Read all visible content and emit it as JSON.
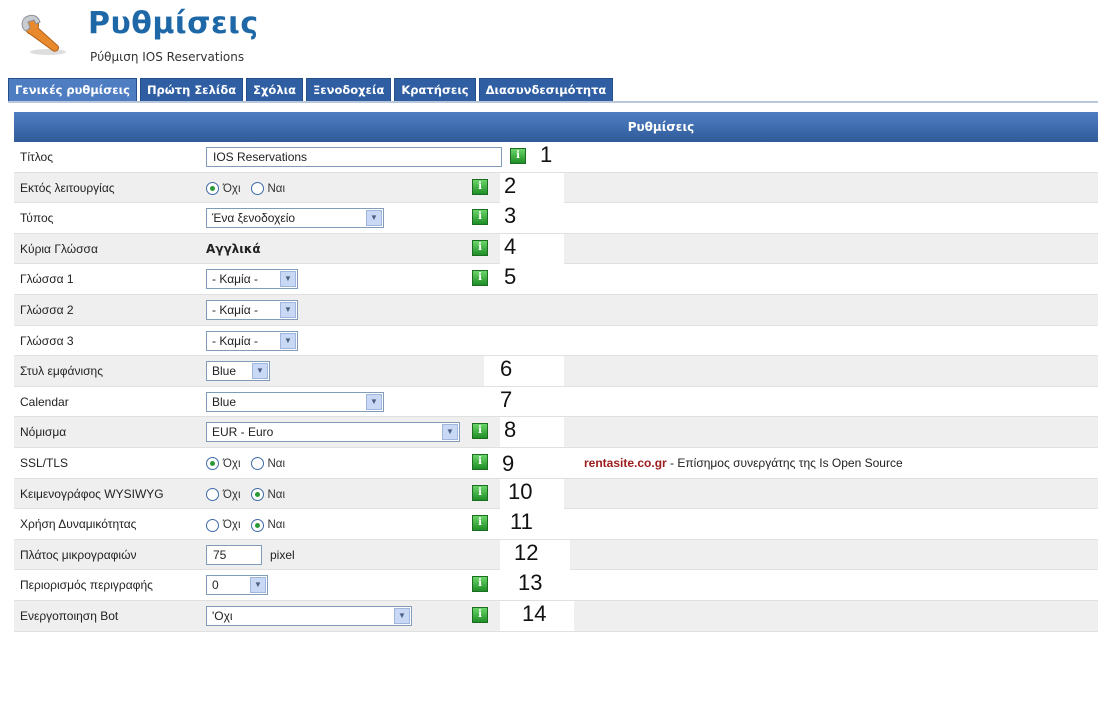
{
  "header": {
    "title": "Ρυθμίσεις",
    "subtitle": "Ρύθμιση IOS Reservations",
    "icon": "wrench-icon"
  },
  "tabs": [
    {
      "label": "Γενικές ρυθμίσεις",
      "active": true
    },
    {
      "label": "Πρώτη Σελίδα"
    },
    {
      "label": "Σχόλια"
    },
    {
      "label": "Ξενοδοχεία"
    },
    {
      "label": "Κρατήσεις"
    },
    {
      "label": "Διασυνδεσιμότητα"
    }
  ],
  "panel": {
    "heading": "Ρυθμίσεις"
  },
  "rows": {
    "title": {
      "label": "Τίτλος",
      "value": "IOS Reservations",
      "note": "1"
    },
    "offline": {
      "label": "Εκτός λειτουργίας",
      "opt_no": "Όχι",
      "opt_yes": "Ναι",
      "note": "2"
    },
    "type": {
      "label": "Τύπος",
      "value": "Ένα ξενοδοχείο",
      "note": "3"
    },
    "main_lang": {
      "label": "Κύρια Γλώσσα",
      "value": "Αγγλικά",
      "note": "4"
    },
    "lang1": {
      "label": "Γλώσσα 1",
      "value": "- Καμία -",
      "note": "5"
    },
    "lang2": {
      "label": "Γλώσσα 2",
      "value": "- Καμία -"
    },
    "lang3": {
      "label": "Γλώσσα 3",
      "value": "- Καμία -"
    },
    "style": {
      "label": "Στυλ εμφάνισης",
      "value": "Blue",
      "note": "6"
    },
    "calendar": {
      "label": "Calendar",
      "value": "Blue",
      "note": "7"
    },
    "currency": {
      "label": "Νόμισμα",
      "value": "EUR - Euro",
      "note": "8"
    },
    "ssl": {
      "label": "SSL/TLS",
      "opt_no": "Όχι",
      "opt_yes": "Ναι",
      "note": "9",
      "promo_site": "rentasite.co.gr",
      "promo_text": " - Επίσημος συνεργάτης της Is Open Source"
    },
    "wysiwyg": {
      "label": "Κειμενογράφος WYSIWYG",
      "opt_no": "Όχι",
      "opt_yes": "Ναι",
      "note": "10"
    },
    "dynamic": {
      "label": "Χρήση Δυναμικότητας",
      "opt_no": "Όχι",
      "opt_yes": "Ναι",
      "note": "11"
    },
    "thumb": {
      "label": "Πλάτος μικρογραφιών",
      "value": "75",
      "unit": "pixel",
      "note": "12"
    },
    "desc_limit": {
      "label": "Περιορισμός περιγραφής",
      "value": "0",
      "note": "13"
    },
    "bot": {
      "label": "Ενεργοποιηση Bot",
      "value": "'Οχι",
      "note": "14"
    }
  },
  "colors": {
    "tab_bg": "#2f5ea3",
    "header_title": "#1f68a8",
    "info_icon": "#2b9a36",
    "promo": "#9b1b1b"
  }
}
